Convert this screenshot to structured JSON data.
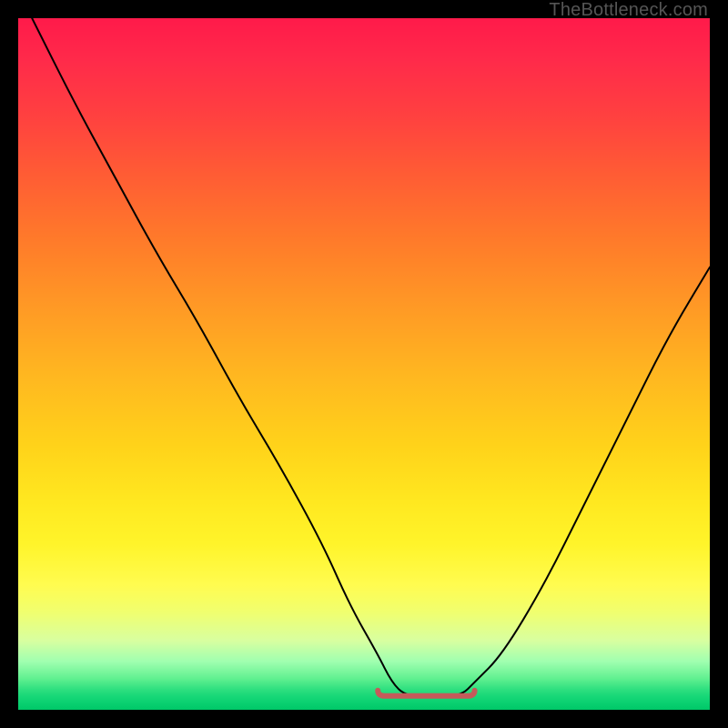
{
  "watermark": "TheBottleneck.com",
  "chart_data": {
    "type": "line",
    "title": "",
    "xlabel": "",
    "ylabel": "",
    "x_range": [
      0,
      100
    ],
    "y_range": [
      0,
      100
    ],
    "series": [
      {
        "name": "bottleneck-curve",
        "x": [
          2,
          8,
          14,
          20,
          26,
          32,
          38,
          44,
          48,
          52,
          54,
          56,
          60,
          64,
          66,
          70,
          76,
          82,
          88,
          94,
          100
        ],
        "values": [
          100,
          88,
          77,
          66,
          56,
          45,
          35,
          24,
          15,
          8,
          4,
          2,
          2,
          2,
          4,
          8,
          18,
          30,
          42,
          54,
          64
        ]
      }
    ],
    "trough_range_x": [
      52,
      66
    ],
    "background_gradient": {
      "top_color": "#ff1a4a",
      "mid_color": "#ffe820",
      "bottom_color": "#00c868"
    },
    "annotations": []
  }
}
